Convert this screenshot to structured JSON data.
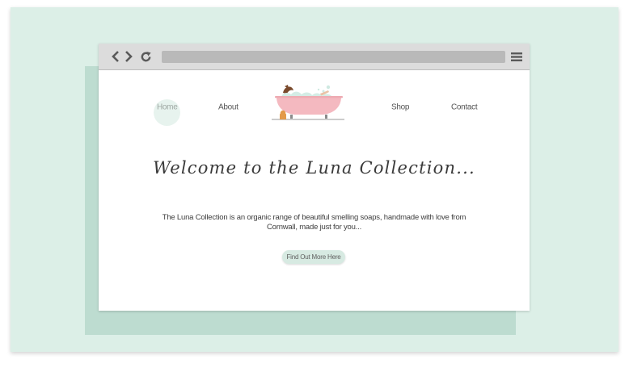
{
  "nav": {
    "home": "Home",
    "about": "About",
    "shop": "Shop",
    "contact": "Contact"
  },
  "hero": {
    "welcome": "Welcome to the Luna Collection...",
    "intro": "The Luna Collection is an organic range of beautiful smelling soaps, handmade with love from Cornwall, made just for you...",
    "cta": "Find Out More Here"
  },
  "icons": {
    "back": "chevron-left-icon",
    "forward": "chevron-right-icon",
    "reload": "reload-icon",
    "menu": "hamburger-menu-icon",
    "logo": "bathtub-logo"
  },
  "colors": {
    "background": "#dcefe7",
    "shadow_block": "#bddcd0",
    "chrome": "#dcdcdc",
    "address_bar": "#b9b9b9",
    "home_highlight": "#e7f3ee",
    "cta_button": "#d7eae2",
    "tub_pink": "#f4b9c0"
  }
}
